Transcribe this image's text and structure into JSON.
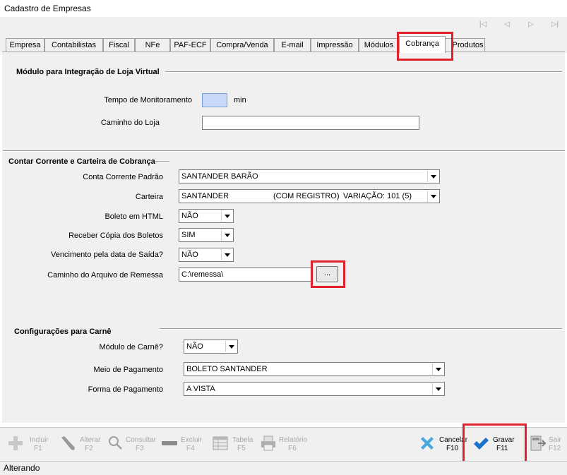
{
  "window": {
    "title": "Cadastro de Empresas"
  },
  "tabs": [
    "Empresa",
    "Contabilistas",
    "Fiscal",
    "NFe",
    "PAF-ECF",
    "Compra/Venda",
    "E-mail",
    "Impressão",
    "Módulos",
    "Cobrança",
    "Produtos"
  ],
  "active_tab": "Cobrança",
  "loja": {
    "title": "Módulo para Integração de Loja Virtual",
    "monitor_label": "Tempo de Monitoramento",
    "monitor_value": "",
    "monitor_unit": "min",
    "path_label": "Caminho do Loja",
    "path_value": ""
  },
  "cobranca": {
    "title": "Contar Corrente e Carteira de Cobrança",
    "conta_label": "Conta Corrente Padrão",
    "conta_value": "SANTANDER BARÃO",
    "carteira_label": "Carteira",
    "carteira_value": "SANTANDER",
    "carteira_value2": "(COM REGISTRO)",
    "carteira_value3": "VARIAÇÃO: 101 (5)",
    "html_label": "Boleto em HTML",
    "html_value": "NÃO",
    "copia_label": "Receber Cópia dos Boletos",
    "copia_value": "SIM",
    "venc_label": "Vencimento pela data de Saída?",
    "venc_value": "NÃO",
    "remessa_label": "Caminho do Arquivo de Remessa",
    "remessa_value": "C:\\remessa\\",
    "browse_label": "..."
  },
  "carne": {
    "title": "Configurações para Carnê",
    "modulo_label": "Módulo de Carnê?",
    "modulo_value": "NÃO",
    "meio_label": "Meio de Pagamento",
    "meio_value": "BOLETO SANTANDER",
    "forma_label": "Forma de Pagamento",
    "forma_value": "A VISTA"
  },
  "toolbar": {
    "incluir": "Incluir",
    "incluir_key": "F1",
    "alterar": "Alterar",
    "alterar_key": "F2",
    "consultar": "Consultar",
    "consultar_key": "F3",
    "excluir": "Excluir",
    "excluir_key": "F4",
    "tabela": "Tabela",
    "tabela_key": "F5",
    "relatorio": "Relatório",
    "relatorio_key": "F6",
    "cancelar": "Cancelar",
    "cancelar_key": "F10",
    "gravar": "Gravar",
    "gravar_key": "F11",
    "sair": "Sair",
    "sair_key": "F12"
  },
  "status": {
    "text": "Alterando"
  },
  "colors": {
    "highlight": "#e0202a",
    "check_blue": "#1a73c8",
    "cancel_blue": "#4aa8e0"
  }
}
